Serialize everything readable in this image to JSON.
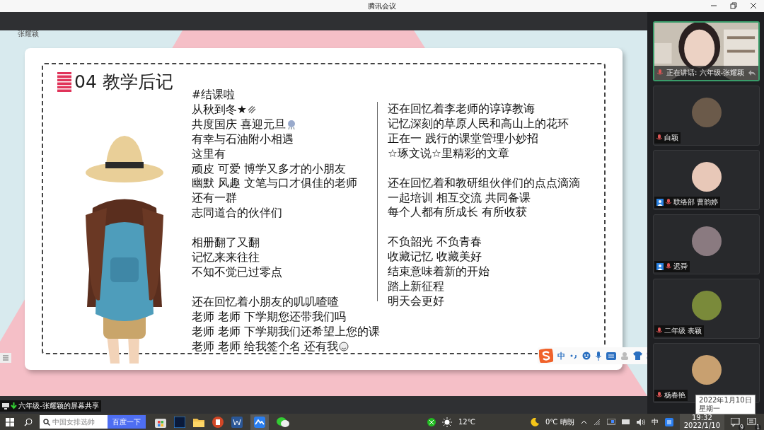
{
  "window": {
    "title": "腾讯会议"
  },
  "presenter_label": "张耀颖",
  "slide": {
    "number": "04",
    "title": "教学后记",
    "left_column": [
      {
        "lines": [
          {
            "text": "#结课啦"
          },
          {
            "text": "从秋到冬★",
            "kind": "sparkle"
          },
          {
            "text": "共度国庆 喜迎元旦",
            "kind": "firework"
          },
          {
            "text": "有幸与石油附小相遇"
          },
          {
            "text": "这里有"
          },
          {
            "text": "顽皮 可爱 博学又多才的小朋友"
          },
          {
            "text": "幽默 风趣 文笔与口才俱佳的老师"
          },
          {
            "text": "还有一群"
          },
          {
            "text": "志同道合的伙伴们"
          }
        ]
      },
      {
        "lines": [
          {
            "text": "相册翻了又翻"
          },
          {
            "text": "记忆来来往往"
          },
          {
            "text": "不知不觉已过零点"
          }
        ]
      },
      {
        "lines": [
          {
            "text": "还在回忆着小朋友的叽叽喳喳"
          },
          {
            "text": "老师 老师 下学期您还带我们吗"
          },
          {
            "text": "老师 老师 下学期我们还希望上您的课"
          },
          {
            "text": "老师 老师 给我签个名 还有我",
            "kind": "emoji"
          }
        ]
      }
    ],
    "right_column": [
      {
        "lines": [
          {
            "text": "还在回忆着李老师的谆谆教诲"
          },
          {
            "text": "记忆深刻的草原人民和高山上的花环"
          },
          {
            "text": "正在一 践行的课堂管理小妙招"
          },
          {
            "text": "☆琢文说☆里精彩的文章"
          }
        ]
      },
      {
        "lines": [
          {
            "text": "还在回忆着和教研组伙伴们的点点滴滴"
          },
          {
            "text": "一起培训 相互交流 共同备课"
          },
          {
            "text": "每个人都有所成长 有所收获"
          }
        ]
      },
      {
        "lines": [
          {
            "text": "不负韶光 不负青春"
          },
          {
            "text": "收藏记忆 收藏美好"
          },
          {
            "text": "结束意味着新的开始"
          },
          {
            "text": "踏上新征程"
          },
          {
            "text": "明天会更好"
          }
        ]
      }
    ]
  },
  "ime_toolbar": {
    "mode": "中"
  },
  "share_label": "六年级-张耀颖的屏幕共享",
  "participants": [
    {
      "kind": "video",
      "name": "正在讲话: 六年级-张耀颖",
      "speaking": true
    },
    {
      "kind": "avatar",
      "name": "白颖",
      "badge": false,
      "color": "#6b5a4a"
    },
    {
      "kind": "avatar",
      "name": "联络部 曹韵婷",
      "badge": true,
      "color": "#e8c8b8"
    },
    {
      "kind": "avatar",
      "name": "迟舜",
      "badge": true,
      "color": "#8a7a80"
    },
    {
      "kind": "avatar",
      "name": "二年级 表颖",
      "badge": false,
      "color": "#7a8a3a"
    },
    {
      "kind": "avatar",
      "name": "杨春艳",
      "badge": false,
      "color": "#c8a070"
    }
  ],
  "taskbar": {
    "search_placeholder": "中国女排选帅",
    "search_button": "百度一下",
    "temperature": "12℃",
    "weather": "0℃ 晴朗",
    "ime": "中",
    "time": "19:32",
    "date": "2022/1/10",
    "notifications_a": "9",
    "notifications_b": "1"
  },
  "tooltip": {
    "date": "2022年1月10日",
    "weekday": "星期一"
  }
}
